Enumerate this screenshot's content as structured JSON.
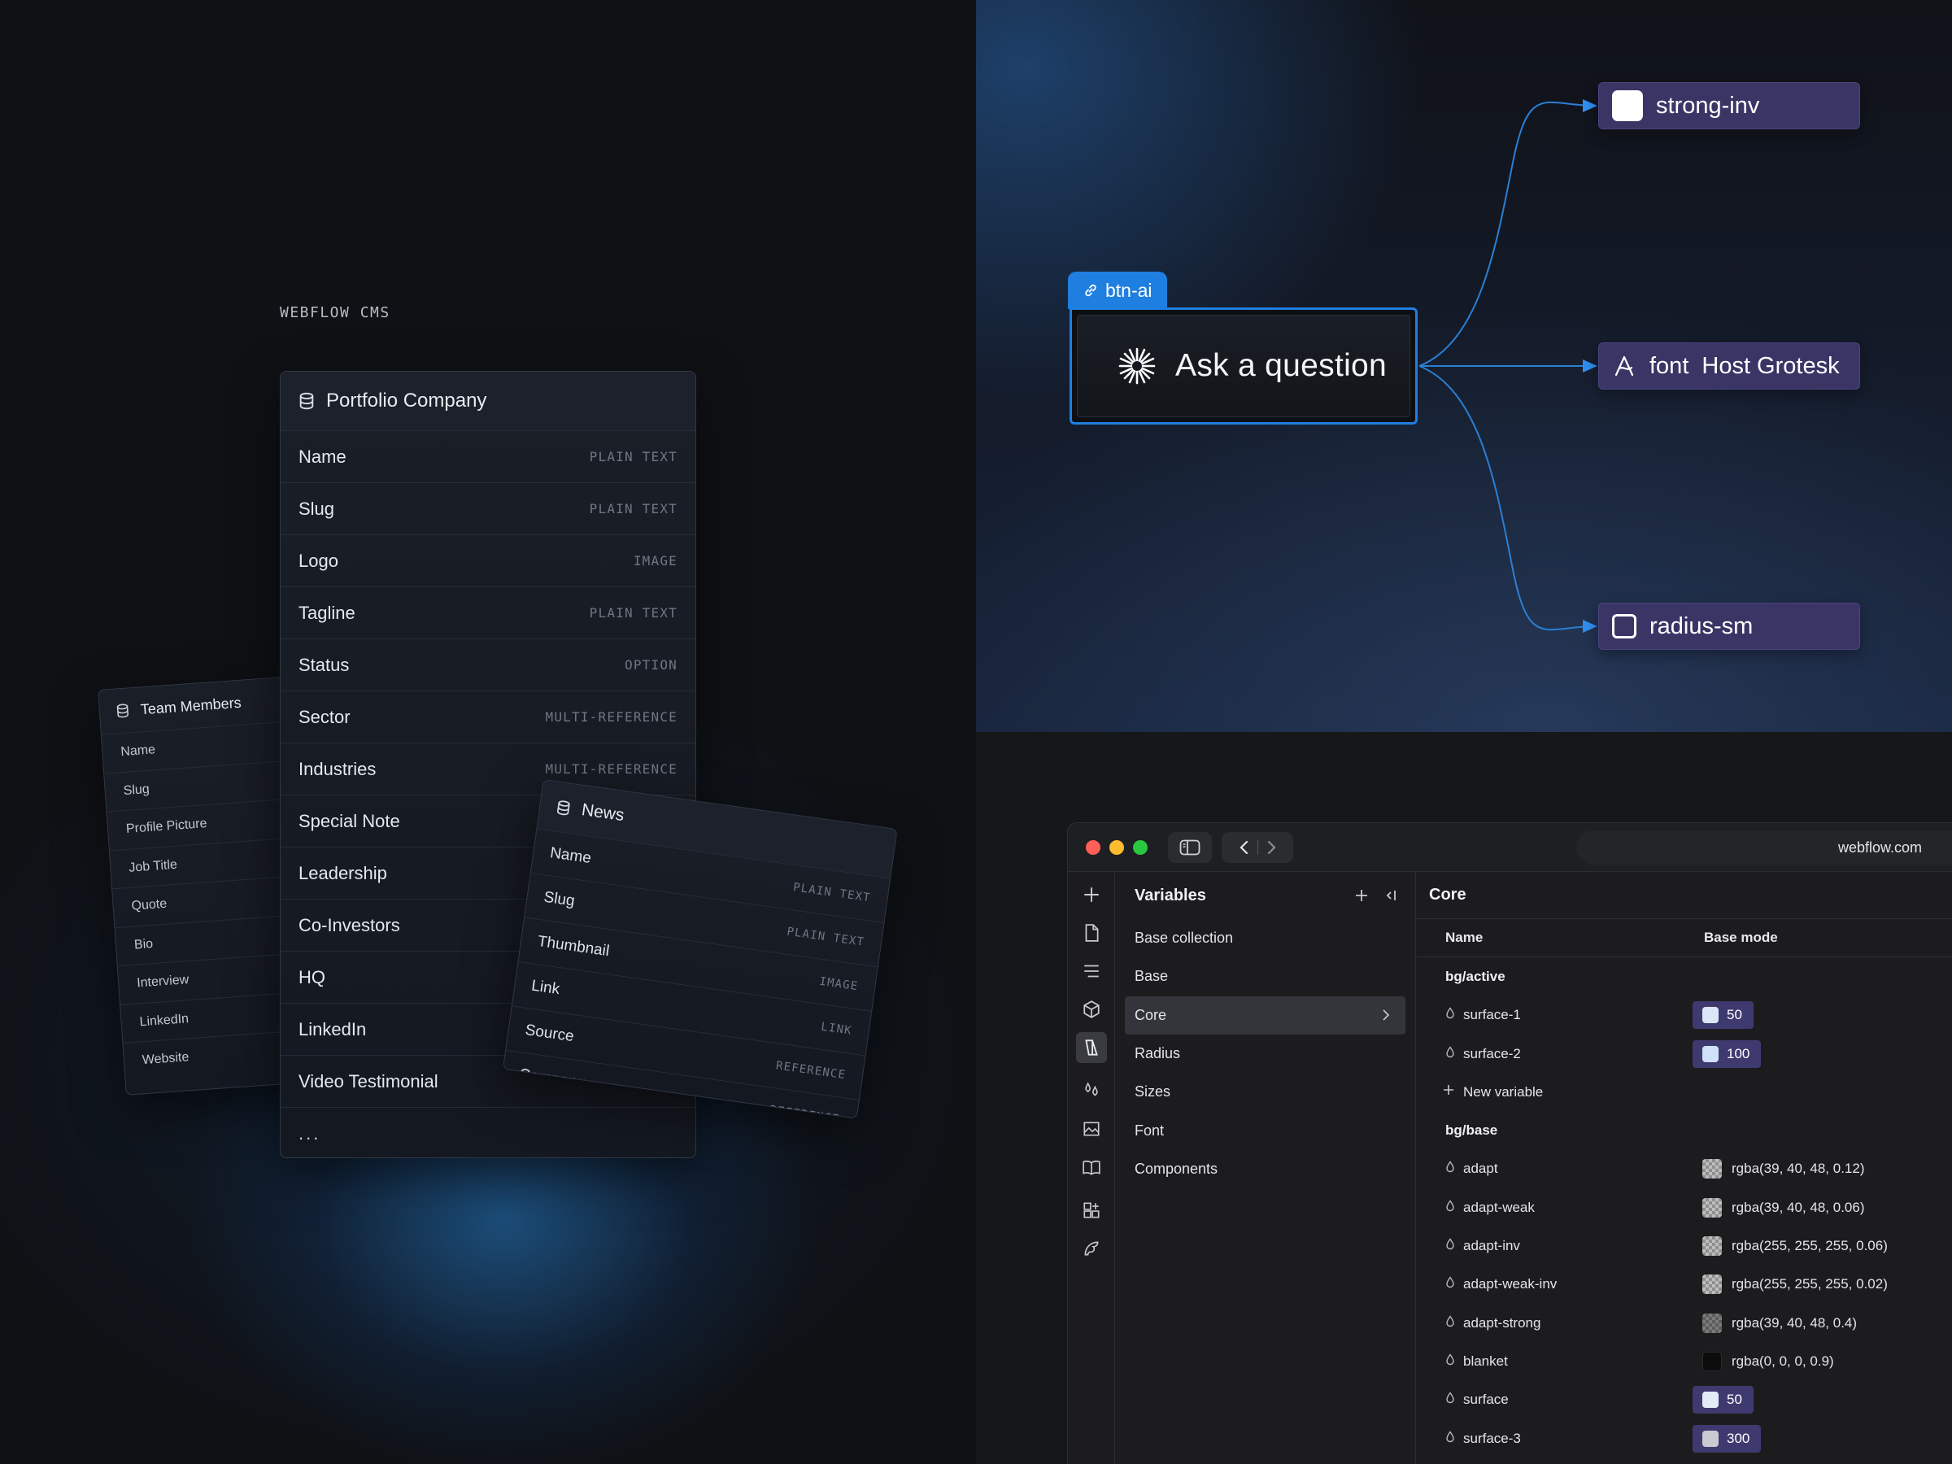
{
  "cms": {
    "label": "WEBFLOW CMS",
    "team_members": {
      "title": "Team Members",
      "fields": [
        "Name",
        "Slug",
        "Profile Picture",
        "Job Title",
        "Quote",
        "Bio",
        "Interview",
        "LinkedIn",
        "Website"
      ]
    },
    "portfolio_company": {
      "title": "Portfolio Company",
      "fields": [
        {
          "name": "Name",
          "type": "PLAIN TEXT"
        },
        {
          "name": "Slug",
          "type": "PLAIN TEXT"
        },
        {
          "name": "Logo",
          "type": "IMAGE"
        },
        {
          "name": "Tagline",
          "type": "PLAIN TEXT"
        },
        {
          "name": "Status",
          "type": "OPTION"
        },
        {
          "name": "Sector",
          "type": "MULTI-REFERENCE"
        },
        {
          "name": "Industries",
          "type": "MULTI-REFERENCE"
        },
        {
          "name": "Special Note",
          "type": ""
        },
        {
          "name": "Leadership",
          "type": ""
        },
        {
          "name": "Co-Investors",
          "type": ""
        },
        {
          "name": "HQ",
          "type": ""
        },
        {
          "name": "LinkedIn",
          "type": ""
        },
        {
          "name": "Video Testimonial",
          "type": ""
        }
      ],
      "more": "..."
    },
    "news": {
      "title": "News",
      "fields": [
        {
          "name": "Name",
          "type": "PLAIN TEXT"
        },
        {
          "name": "Slug",
          "type": "PLAIN TEXT"
        },
        {
          "name": "Thumbnail",
          "type": "IMAGE"
        },
        {
          "name": "Link",
          "type": "LINK"
        },
        {
          "name": "Source",
          "type": "REFERENCE"
        },
        {
          "name": "Company",
          "type": "REFERENCE"
        }
      ]
    }
  },
  "flow": {
    "tag": "btn-ai",
    "button_text": "Ask a question",
    "tokens": {
      "strong": "strong-inv",
      "font_label": "font",
      "font_value": "Host Grotesk",
      "radius": "radius-sm"
    },
    "accent_color": "#1e7fe0",
    "token_color": "#3a3565"
  },
  "app": {
    "url": "webflow.com",
    "traffic_lights": [
      "#ff5f57",
      "#febc2e",
      "#28c840"
    ],
    "rail_icons": [
      "add-icon",
      "page-icon",
      "navigator-icon",
      "components-icon",
      "variables-icon",
      "styles-icon",
      "assets-icon",
      "cms-icon",
      "apps-icon",
      "settings-icon"
    ],
    "variables": {
      "title": "Variables",
      "collections": [
        "Base collection",
        "Base",
        "Core",
        "Radius",
        "Sizes",
        "Font",
        "Components"
      ],
      "selected": "Core"
    },
    "core": {
      "title": "Core",
      "columns": [
        "Name",
        "Base mode"
      ],
      "groups": [
        {
          "name": "bg/active",
          "rows": [
            {
              "name": "surface-1",
              "value": "50",
              "kind": "pill",
              "swatch": "#dbe6f7"
            },
            {
              "name": "surface-2",
              "value": "100",
              "kind": "pill",
              "swatch": "#cfe0f8"
            }
          ],
          "new_variable": "New variable"
        },
        {
          "name": "bg/base",
          "rows": [
            {
              "name": "adapt",
              "value": "rgba(39, 40, 48, 0.12)",
              "kind": "checker"
            },
            {
              "name": "adapt-weak",
              "value": "rgba(39, 40, 48, 0.06)",
              "kind": "checker"
            },
            {
              "name": "adapt-inv",
              "value": "rgba(255, 255, 255, 0.06)",
              "kind": "checker"
            },
            {
              "name": "adapt-weak-inv",
              "value": "rgba(255, 255, 255, 0.02)",
              "kind": "checker"
            },
            {
              "name": "adapt-strong",
              "value": "rgba(39, 40, 48, 0.4)",
              "kind": "checker-dark"
            },
            {
              "name": "blanket",
              "value": "rgba(0, 0, 0, 0.9)",
              "kind": "black"
            },
            {
              "name": "surface",
              "value": "50",
              "kind": "pill",
              "swatch": "#e4ebf6"
            },
            {
              "name": "surface-3",
              "value": "300",
              "kind": "pill",
              "swatch": "#c9cbd4"
            }
          ]
        }
      ]
    }
  }
}
